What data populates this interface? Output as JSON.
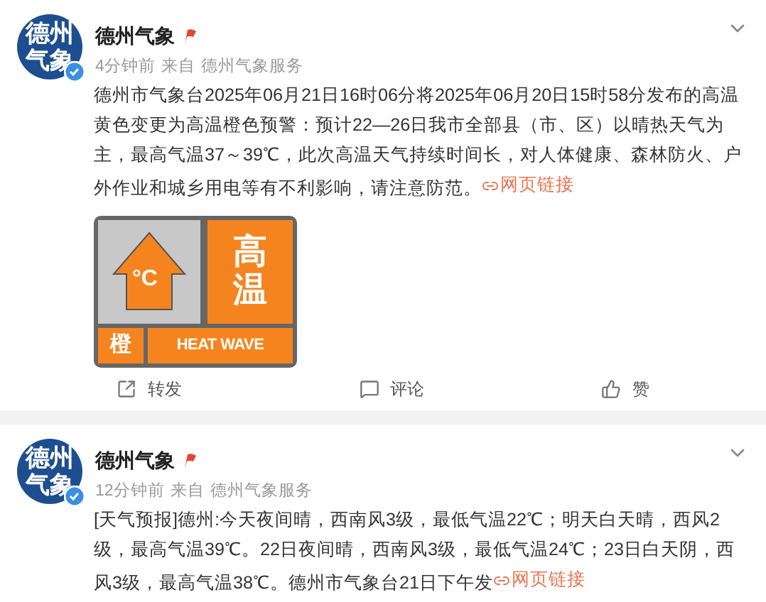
{
  "posts": [
    {
      "avatar_text": "德州气象",
      "author": "德州气象",
      "time": "4分钟前",
      "source_prefix": "来自",
      "source": "德州气象服务",
      "body": "德州市气象台2025年06月21日16时06分将2025年06月20日15时58分发布的高温黄色变更为高温橙色预警：预计22—26日我市全部县（市、区）以晴热天气为主，最高气温37～39℃，此次高温天气持续时间长，对人体健康、森林防火、户外作业和城乡用电等有不利影响，请注意防范。",
      "link": "网页链接",
      "sign": {
        "unit": "°C",
        "title": "高温",
        "level": "橙",
        "english": "HEAT WAVE"
      },
      "actions": [
        {
          "kind": "share",
          "label": "转发"
        },
        {
          "kind": "comment",
          "label": "评论"
        },
        {
          "kind": "like",
          "label": "赞"
        }
      ]
    },
    {
      "avatar_text": "德州气象",
      "author": "德州气象",
      "time": "12分钟前",
      "source_prefix": "来自",
      "source": "德州气象服务",
      "body": "[天气预报]德州:今天夜间晴，西南风3级，最低气温22℃；明天白天晴，西风2级，最高气温39℃。22日夜间晴，西南风3级，最低气温24℃；23日白天阴，西风3级，最高气温38℃。德州市气象台21日下午发",
      "link": "网页链接"
    }
  ]
}
